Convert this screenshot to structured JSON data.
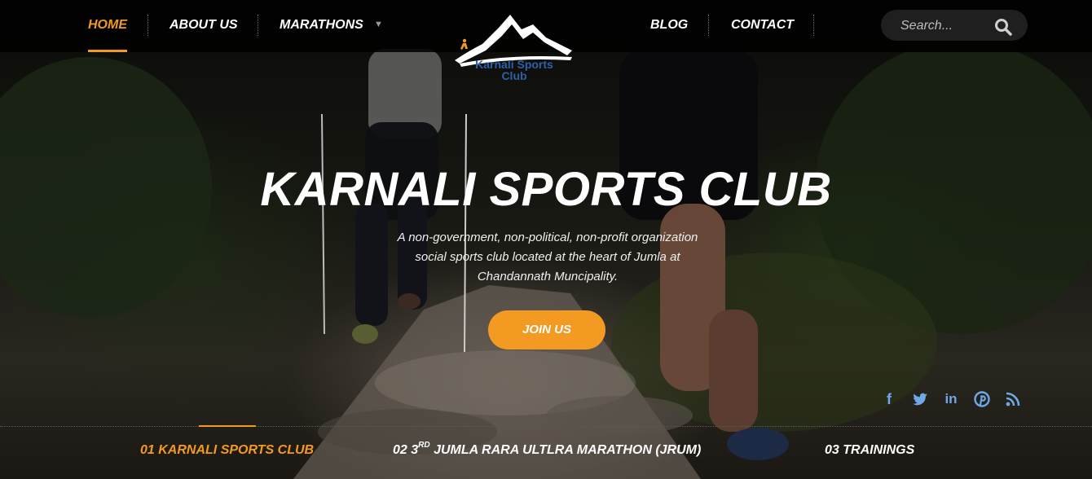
{
  "nav": {
    "home": "HOME",
    "about": "ABOUT US",
    "marathons": "MARATHONS",
    "marathons_caret": "▼",
    "blog": "BLOG",
    "contact": "CONTACT"
  },
  "logo": {
    "line1": "Karnali Sports",
    "line2": "Club"
  },
  "search": {
    "placeholder": "Search..."
  },
  "hero": {
    "title": "KARNALI SPORTS CLUB",
    "description": "A non-government, non-political, non-profit organization social sports club located at the heart of Jumla at Chandannath Muncipality.",
    "cta": "JOIN US"
  },
  "social": {
    "facebook": "f",
    "twitter": "twitter-icon",
    "linkedin": "in",
    "pinterest": "pinterest-icon",
    "rss": "rss-icon"
  },
  "slides": [
    {
      "number": "01",
      "label": "KARNALI SPORTS CLUB"
    },
    {
      "number": "02",
      "prefix": "3",
      "sup": "RD",
      "label": "JUMLA RARA ULTLRA MARATHON (JRUM)"
    },
    {
      "number": "03",
      "label": "TRAININGS"
    }
  ],
  "colors": {
    "accent": "#f39a22",
    "social": "#6fa8e6",
    "logo_text": "#2e5fa8"
  }
}
